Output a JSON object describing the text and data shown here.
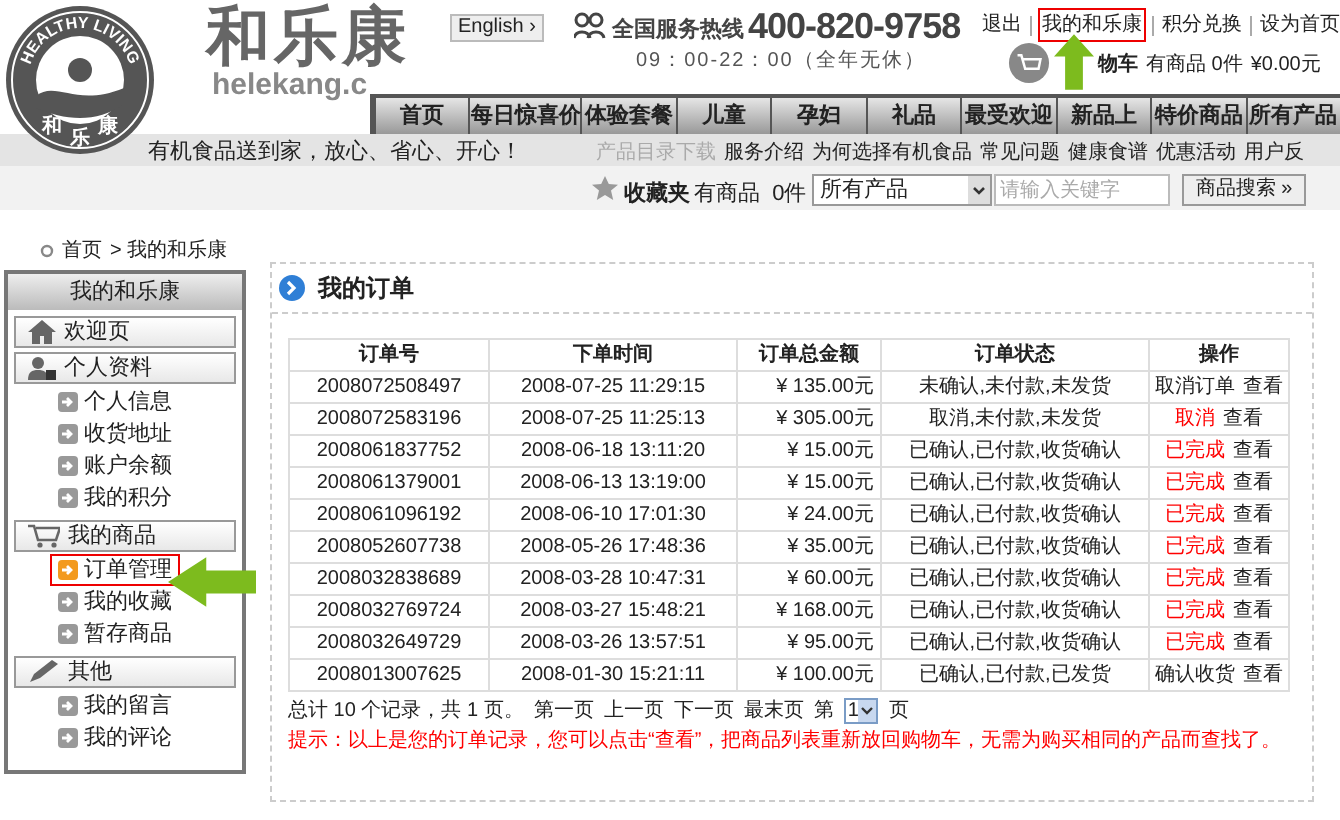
{
  "logo": {
    "arc_text": "HEALTHY LIVING",
    "chars": [
      "和",
      "乐",
      "康"
    ],
    "title": "和乐康",
    "domain": "helekang.c"
  },
  "language_button": "English ›",
  "hotline": {
    "label": "全国服务热线",
    "number": "400-820-9758",
    "hours": "09：00-22：00（全年无休）"
  },
  "top_links": [
    {
      "label": "退出",
      "selected": false
    },
    {
      "label": "我的和乐康",
      "selected": true
    },
    {
      "label": "积分兑换",
      "selected": false
    },
    {
      "label": "设为首页",
      "selected": false
    }
  ],
  "cart": {
    "label": "物车",
    "count": "有商品 0件",
    "total": "¥0.00元"
  },
  "nav": [
    {
      "label": "首页"
    },
    {
      "label": "每日惊喜价"
    },
    {
      "label": "体验套餐"
    },
    {
      "label": "儿童"
    },
    {
      "label": "孕妇"
    },
    {
      "label": "礼品"
    },
    {
      "label": "最受欢迎"
    },
    {
      "label": "新品上"
    },
    {
      "label": "特价商品"
    },
    {
      "label": "所有产品"
    }
  ],
  "slogan": "有机食品送到家，放心、省心、开心！",
  "sub_links": [
    {
      "label": "产品目录下载",
      "disabled": true
    },
    {
      "label": "服务介绍",
      "disabled": false
    },
    {
      "label": "为何选择有机食品",
      "disabled": false
    },
    {
      "label": "常见问题",
      "disabled": false
    },
    {
      "label": "健康食谱",
      "disabled": false
    },
    {
      "label": "优惠活动",
      "disabled": false
    },
    {
      "label": "用户反",
      "disabled": false
    }
  ],
  "favorites": {
    "label": "收藏夹",
    "count": "有商品  0件"
  },
  "search": {
    "category": "所有产品",
    "placeholder": "请输入关键字",
    "button": "商品搜索 »"
  },
  "breadcrumb": [
    "首页",
    "> 我的和乐康"
  ],
  "sidebar": {
    "title": "我的和乐康",
    "sections": [
      {
        "kind": "home",
        "label": "欢迎页"
      },
      {
        "kind": "profile",
        "label": "个人资料",
        "items": [
          {
            "label": "个人信息",
            "selected": false
          },
          {
            "label": "收货地址",
            "selected": false
          },
          {
            "label": "账户余额",
            "selected": false
          },
          {
            "label": "我的积分",
            "selected": false
          }
        ]
      },
      {
        "kind": "cart",
        "label": "我的商品",
        "items": [
          {
            "label": "订单管理",
            "selected": true
          },
          {
            "label": "我的收藏",
            "selected": false
          },
          {
            "label": "暂存商品",
            "selected": false
          }
        ]
      },
      {
        "kind": "pencil",
        "label": "其他",
        "items": [
          {
            "label": "我的留言",
            "selected": false
          },
          {
            "label": "我的评论",
            "selected": false
          }
        ]
      }
    ]
  },
  "main": {
    "title": "我的订单",
    "table": {
      "columns": [
        "订单号",
        "下单时间",
        "订单总金额",
        "订单状态",
        "操作"
      ],
      "rows": [
        {
          "id": "2008072508497",
          "time": "2008-07-25 11:29:15",
          "amount": "¥ 135.00元",
          "status": "未确认,未付款,未发货",
          "action": "取消订单",
          "alert": false,
          "view": "查看"
        },
        {
          "id": "2008072583196",
          "time": "2008-07-25 11:25:13",
          "amount": "¥ 305.00元",
          "status": "取消,未付款,未发货",
          "action": "取消",
          "alert": true,
          "view": "查看"
        },
        {
          "id": "2008061837752",
          "time": "2008-06-18 13:11:20",
          "amount": "¥ 15.00元",
          "status": "已确认,已付款,收货确认",
          "action": "已完成",
          "alert": true,
          "view": "查看"
        },
        {
          "id": "2008061379001",
          "time": "2008-06-13 13:19:00",
          "amount": "¥ 15.00元",
          "status": "已确认,已付款,收货确认",
          "action": "已完成",
          "alert": true,
          "view": "查看"
        },
        {
          "id": "2008061096192",
          "time": "2008-06-10 17:01:30",
          "amount": "¥ 24.00元",
          "status": "已确认,已付款,收货确认",
          "action": "已完成",
          "alert": true,
          "view": "查看"
        },
        {
          "id": "2008052607738",
          "time": "2008-05-26 17:48:36",
          "amount": "¥ 35.00元",
          "status": "已确认,已付款,收货确认",
          "action": "已完成",
          "alert": true,
          "view": "查看"
        },
        {
          "id": "2008032838689",
          "time": "2008-03-28 10:47:31",
          "amount": "¥ 60.00元",
          "status": "已确认,已付款,收货确认",
          "action": "已完成",
          "alert": true,
          "view": "查看"
        },
        {
          "id": "2008032769724",
          "time": "2008-03-27 15:48:21",
          "amount": "¥ 168.00元",
          "status": "已确认,已付款,收货确认",
          "action": "已完成",
          "alert": true,
          "view": "查看"
        },
        {
          "id": "2008032649729",
          "time": "2008-03-26 13:57:51",
          "amount": "¥ 95.00元",
          "status": "已确认,已付款,收货确认",
          "action": "已完成",
          "alert": true,
          "view": "查看"
        },
        {
          "id": "2008013007625",
          "time": "2008-01-30 15:21:11",
          "amount": "¥ 100.00元",
          "status": "已确认,已付款,已发货",
          "action": "确认收货",
          "alert": false,
          "view": "查看"
        }
      ]
    },
    "pagination": {
      "summary": "总计 10 个记录，共 1 页。",
      "links": [
        "第一页",
        "上一页",
        "下一页",
        "最末页"
      ],
      "prefix": "第",
      "page": "1",
      "suffix": "页"
    },
    "tip": "提示：以上是您的订单记录，您可以点击“查看”，把商品列表重新放回购物车，无需为购买相同的产品而查找了。"
  }
}
